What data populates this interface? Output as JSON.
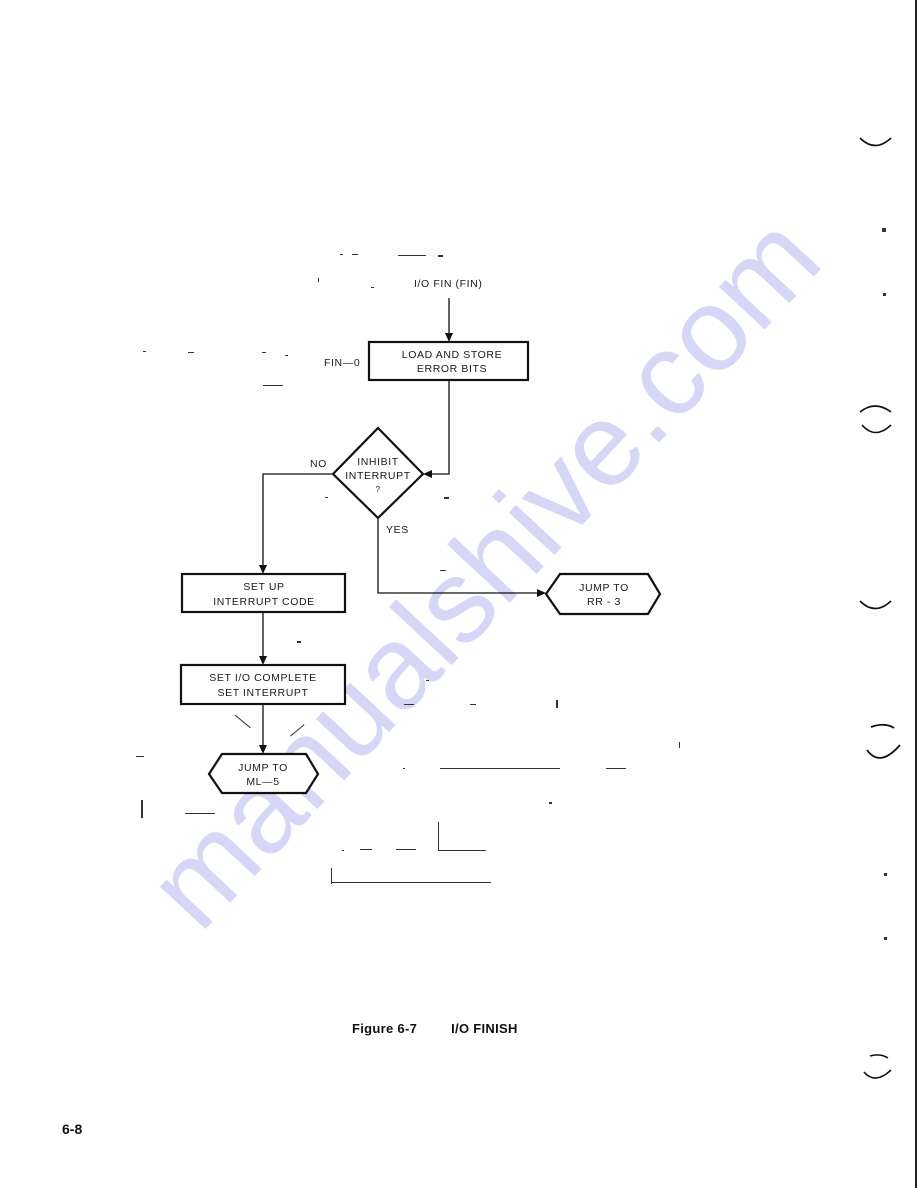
{
  "document": {
    "type": "scanned-manual-page",
    "page_number": "6-8",
    "watermark": "manualshive.com",
    "colors": {
      "ink": "#111111",
      "paper": "#ffffff",
      "watermark": "#c8c8f4"
    }
  },
  "figure": {
    "number": "Figure 6-7",
    "title": "I/O FINISH",
    "entry_label": "I/O FIN (FIN)",
    "side_label": "FIN—0"
  },
  "flowchart": {
    "nodes": {
      "load_store": {
        "shape": "process",
        "lines": [
          "LOAD AND STORE",
          "ERROR BITS"
        ]
      },
      "inhibit": {
        "shape": "decision",
        "lines": [
          "INHIBIT",
          "INTERRUPT",
          "?"
        ]
      },
      "set_up": {
        "shape": "process",
        "lines": [
          "SET UP",
          "INTERRUPT CODE"
        ]
      },
      "set_io": {
        "shape": "process",
        "lines": [
          "SET I/O COMPLETE",
          "SET INTERRUPT"
        ]
      },
      "jump_rr3": {
        "shape": "terminal-hexagon",
        "lines": [
          "JUMP TO",
          "RR - 3"
        ]
      },
      "jump_ml5": {
        "shape": "terminal-hexagon",
        "lines": [
          "JUMP TO",
          "ML—5"
        ]
      }
    },
    "branch_labels": {
      "no": "NO",
      "yes": "YES"
    },
    "edges": [
      {
        "from": "entry",
        "to": "load_store"
      },
      {
        "from": "load_store",
        "to": "inhibit"
      },
      {
        "from": "inhibit",
        "to": "set_up",
        "label": "NO"
      },
      {
        "from": "inhibit",
        "to": "jump_rr3",
        "label": "YES"
      },
      {
        "from": "set_up",
        "to": "set_io"
      },
      {
        "from": "set_io",
        "to": "jump_ml5"
      }
    ]
  }
}
